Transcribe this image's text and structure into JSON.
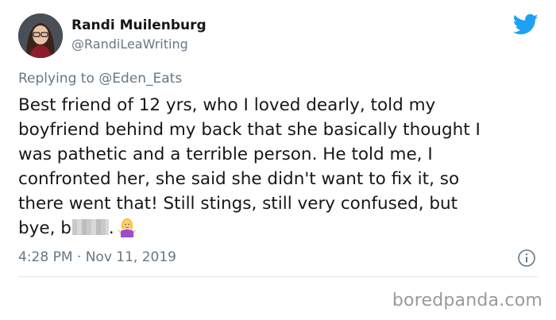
{
  "author": {
    "display_name": "Randi Muilenburg",
    "handle": "@RandiLeaWriting"
  },
  "reply": {
    "prefix": "Replying to ",
    "mention": "@Eden_Eats"
  },
  "tweet": {
    "lines": [
      "Best friend of 12 yrs, who I loved dearly, told my",
      "boyfriend behind my back that she basically thought I",
      "was pathetic and a terrible person. He told me, I",
      "confronted her, she said she didn't want to fix it, so",
      "there went that! Still stings, still very confused, but"
    ],
    "last_line_start": "bye, b",
    "last_line_end": ".",
    "emoji": "woman-shrugging-emoji"
  },
  "timestamp": "4:28 PM · Nov 11, 2019",
  "icons": {
    "brand": "twitter-bird-icon",
    "info": "info-icon",
    "twitter_blue": "#1da1f2"
  },
  "watermark": "boredpanda.com"
}
